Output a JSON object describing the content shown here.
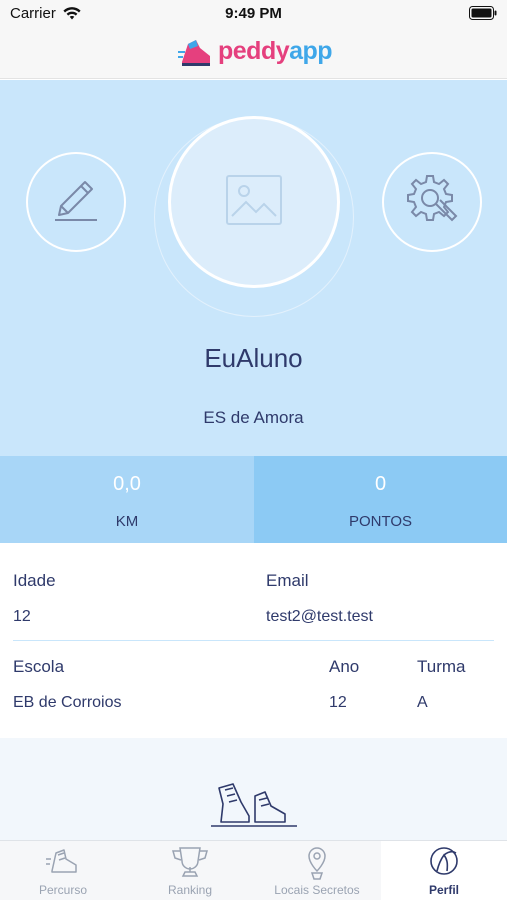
{
  "status_bar": {
    "carrier": "Carrier",
    "time": "9:49 PM"
  },
  "header": {
    "logo_part1": "peddy",
    "logo_part2": "app"
  },
  "profile": {
    "name": "EuAluno",
    "school": "ES de Amora",
    "icons": {
      "edit": "pencil-icon",
      "settings": "gear-wrench-icon",
      "avatar": "image-placeholder-icon"
    }
  },
  "stats": {
    "km_value": "0,0",
    "km_label": "KM",
    "points_value": "0",
    "points_label": "PONTOS"
  },
  "details": {
    "age_label": "Idade",
    "age_value": "12",
    "email_label": "Email",
    "email_value": "test2@test.test",
    "school_label": "Escola",
    "school_value": "EB de Corroios",
    "year_label": "Ano",
    "year_value": "12",
    "class_label": "Turma",
    "class_value": "A"
  },
  "tabs": [
    {
      "label": "Percurso",
      "icon": "shoe-icon",
      "active": false
    },
    {
      "label": "Ranking",
      "icon": "trophy-icon",
      "active": false
    },
    {
      "label": "Locais Secretos",
      "icon": "map-pin-icon",
      "active": false
    },
    {
      "label": "Perfil",
      "icon": "profile-icon",
      "active": true
    }
  ],
  "colors": {
    "primary_text": "#2f3a6b",
    "hero_bg": "#c9e6fb",
    "stat_left_bg": "#a8d6f7",
    "stat_right_bg": "#8ccaf4",
    "logo_pink": "#e5407e",
    "logo_blue": "#3fa7e9"
  }
}
